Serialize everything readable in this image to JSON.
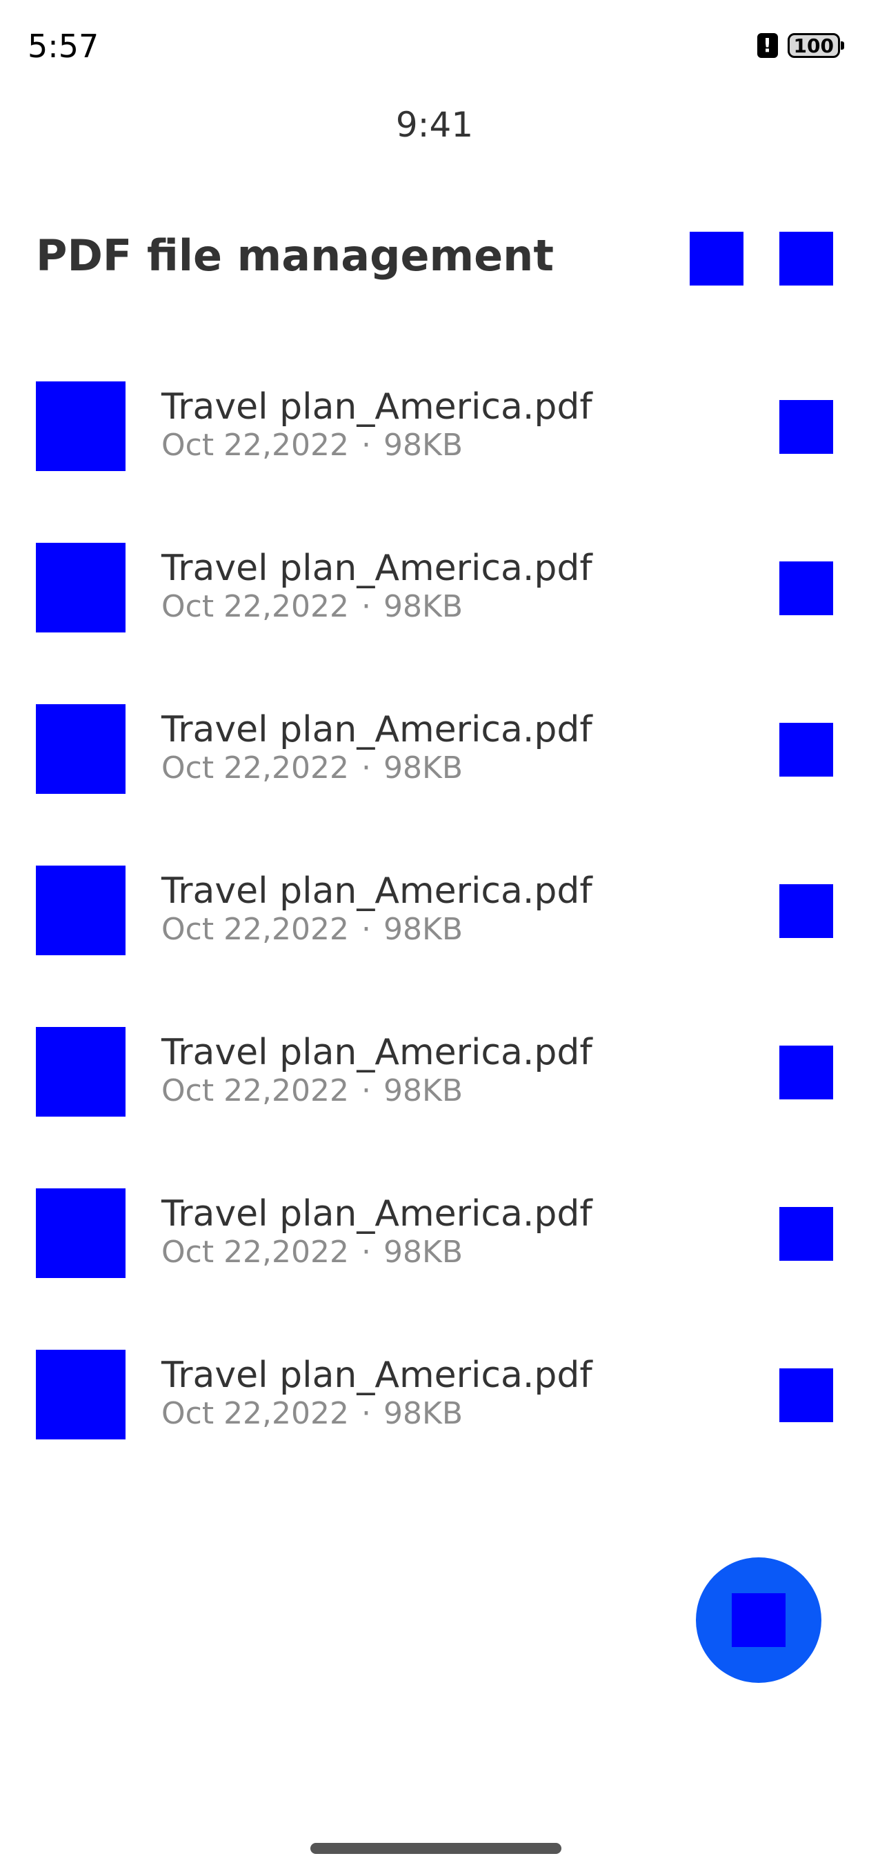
{
  "status_bar": {
    "time": "5:57",
    "alert_icon": "alert-icon",
    "battery": "100"
  },
  "sub_time": "9:41",
  "header": {
    "title": "PDF file management",
    "actions": [
      "header-action-icon",
      "header-action-icon"
    ]
  },
  "files": [
    {
      "name": "Travel plan_America.pdf",
      "date": "Oct 22,2022",
      "separator": "·",
      "size": "98KB"
    },
    {
      "name": "Travel plan_America.pdf",
      "date": "Oct 22,2022",
      "separator": "·",
      "size": "98KB"
    },
    {
      "name": "Travel plan_America.pdf",
      "date": "Oct 22,2022",
      "separator": "·",
      "size": "98KB"
    },
    {
      "name": "Travel plan_America.pdf",
      "date": "Oct 22,2022",
      "separator": "·",
      "size": "98KB"
    },
    {
      "name": "Travel plan_America.pdf",
      "date": "Oct 22,2022",
      "separator": "·",
      "size": "98KB"
    },
    {
      "name": "Travel plan_America.pdf",
      "date": "Oct 22,2022",
      "separator": "·",
      "size": "98KB"
    },
    {
      "name": "Travel plan_America.pdf",
      "date": "Oct 22,2022",
      "separator": "·",
      "size": "98KB"
    }
  ],
  "colors": {
    "icon_placeholder": "#0000ff",
    "fab": "#0a59f7",
    "title_text": "#333333",
    "meta_text": "#8c8c8c"
  }
}
